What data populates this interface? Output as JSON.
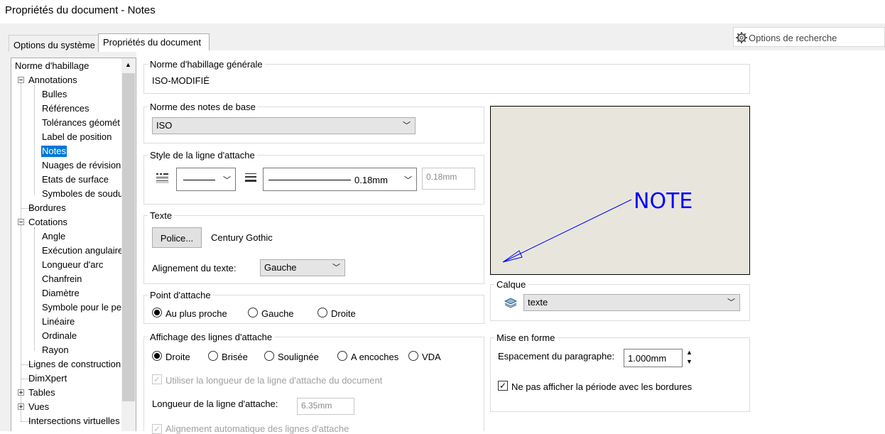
{
  "window": {
    "title": "Propriétés du document - Notes"
  },
  "tabs": [
    {
      "label": "Options du système"
    },
    {
      "label": "Propriétés du document"
    }
  ],
  "search": {
    "label": "Options de recherche",
    "icon": "gear-icon"
  },
  "tree": {
    "items": [
      {
        "label": "Norme d'habillage"
      },
      {
        "label": "Annotations"
      },
      {
        "label": "Bulles"
      },
      {
        "label": "Références"
      },
      {
        "label": "Tolérances géomét"
      },
      {
        "label": "Label de position"
      },
      {
        "label": "Notes"
      },
      {
        "label": "Nuages de révision"
      },
      {
        "label": "Etats de surface"
      },
      {
        "label": "Symboles de soudu"
      },
      {
        "label": "Bordures"
      },
      {
        "label": "Cotations"
      },
      {
        "label": "Angle"
      },
      {
        "label": "Exécution angulaire"
      },
      {
        "label": "Longueur d'arc"
      },
      {
        "label": "Chanfrein"
      },
      {
        "label": "Diamètre"
      },
      {
        "label": "Symbole pour le pe"
      },
      {
        "label": "Linéaire"
      },
      {
        "label": "Ordinale"
      },
      {
        "label": "Rayon"
      },
      {
        "label": "Lignes de construction"
      },
      {
        "label": "DimXpert"
      },
      {
        "label": "Tables"
      },
      {
        "label": "Vues"
      },
      {
        "label": "Intersections virtuelles"
      }
    ]
  },
  "general": {
    "label": "Norme d'habillage générale",
    "value": "ISO-MODIFIÉ"
  },
  "base": {
    "label": "Norme des notes de base",
    "value": "ISO"
  },
  "leader_style": {
    "label": "Style de la ligne d'attache",
    "thickness": "0.18mm",
    "custom": "0.18mm"
  },
  "text": {
    "label": "Texte",
    "font_button": "Police...",
    "font_name": "Century Gothic",
    "align_label": "Alignement du texte:",
    "align_value": "Gauche"
  },
  "attach": {
    "label": "Point d'attache",
    "options": [
      "Au plus proche",
      "Gauche",
      "Droite"
    ],
    "selected": 0
  },
  "leader_display": {
    "label": "Affichage des lignes d'attache",
    "options": [
      "Droite",
      "Brisée",
      "Soulignée",
      "A encoches",
      "VDA"
    ],
    "selected": 0,
    "use_doc_length": "Utiliser la longueur de la ligne d'attache du document",
    "length_label": "Longueur de la ligne d'attache:",
    "length_value": "6.35mm",
    "auto_align": "Alignement automatique des lignes d'attache"
  },
  "preview": {
    "note_text": "NOTE",
    "color": "#0000ff"
  },
  "calque": {
    "label": "Calque",
    "value": "texte"
  },
  "format": {
    "label": "Mise en forme",
    "spacing_label": "Espacement du paragraphe:",
    "spacing_value": "1.000mm",
    "period_label": "Ne pas afficher la période avec les bordures",
    "period_checked": true
  }
}
